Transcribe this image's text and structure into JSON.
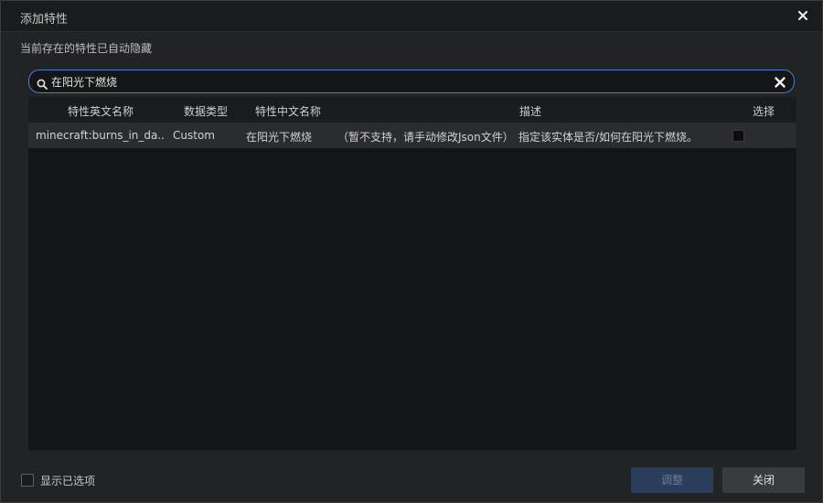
{
  "dialog": {
    "title": "添加特性",
    "info": "当前存在的特性已自动隐藏"
  },
  "search": {
    "value": "在阳光下燃烧"
  },
  "table": {
    "headers": [
      "特性英文名称",
      "数据类型",
      "特性中文名称",
      "描述",
      "选择"
    ],
    "rows": [
      {
        "en_name": "minecraft:burns_in_da...",
        "type": "Custom",
        "cn_name": "在阳光下燃烧",
        "note": "（暂不支持，请手动修改Json文件）",
        "desc": "指定该实体是否/如何在阳光下燃烧。"
      }
    ]
  },
  "footer": {
    "show_selected_label": "显示已选项",
    "adjust_label": "调整",
    "close_label": "关闭"
  },
  "icons": {
    "close": "close-icon",
    "search": "search-icon",
    "clear": "clear-icon"
  },
  "colors": {
    "accent": "#4a7fd0",
    "adjust_button_bg": "#2a3e5c"
  }
}
